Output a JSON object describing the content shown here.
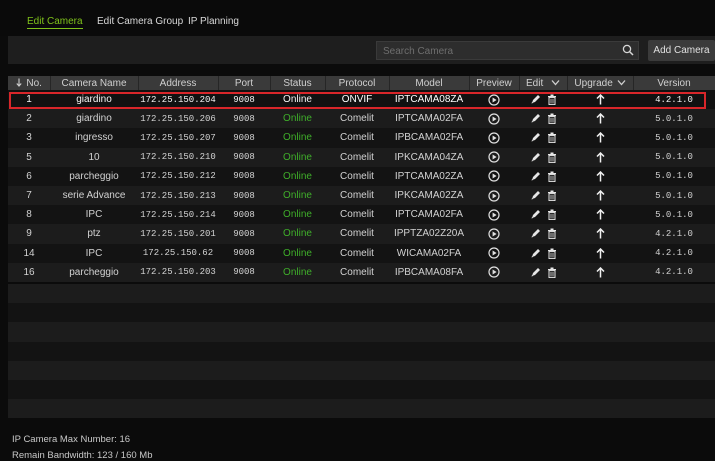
{
  "tabs": [
    {
      "label": "Edit Camera",
      "active": true
    },
    {
      "label": "Edit Camera Group",
      "active": false
    },
    {
      "label": "IP Planning",
      "active": false
    }
  ],
  "toolbar": {
    "search_placeholder": "Search Camera",
    "search_value": "",
    "add_label": "Add Camera"
  },
  "table": {
    "columns": [
      "No.",
      "Camera Name",
      "Address",
      "Port",
      "Status",
      "Protocol",
      "Model",
      "Preview",
      "Edit",
      "Upgrade",
      "Version"
    ],
    "rows": [
      {
        "no": "1",
        "name": "giardino",
        "address": "172.25.150.204",
        "port": "9008",
        "status": "Online",
        "protocol": "ONVIF",
        "model": "IPTCAMA08ZA",
        "version": "4.2.1.0"
      },
      {
        "no": "2",
        "name": "giardino",
        "address": "172.25.150.206",
        "port": "9008",
        "status": "Online",
        "protocol": "Comelit",
        "model": "IPTCAMA02FA",
        "version": "5.0.1.0"
      },
      {
        "no": "3",
        "name": "ingresso",
        "address": "172.25.150.207",
        "port": "9008",
        "status": "Online",
        "protocol": "Comelit",
        "model": "IPBCAMA02FA",
        "version": "5.0.1.0"
      },
      {
        "no": "5",
        "name": "10",
        "address": "172.25.150.210",
        "port": "9008",
        "status": "Online",
        "protocol": "Comelit",
        "model": "IPKCAMA04ZA",
        "version": "5.0.1.0"
      },
      {
        "no": "6",
        "name": "parcheggio",
        "address": "172.25.150.212",
        "port": "9008",
        "status": "Online",
        "protocol": "Comelit",
        "model": "IPTCAMA02ZA",
        "version": "5.0.1.0"
      },
      {
        "no": "7",
        "name": "serie Advance",
        "address": "172.25.150.213",
        "port": "9008",
        "status": "Online",
        "protocol": "Comelit",
        "model": "IPKCAMA02ZA",
        "version": "5.0.1.0"
      },
      {
        "no": "8",
        "name": "IPC",
        "address": "172.25.150.214",
        "port": "9008",
        "status": "Online",
        "protocol": "Comelit",
        "model": "IPTCAMA02FA",
        "version": "5.0.1.0"
      },
      {
        "no": "9",
        "name": "ptz",
        "address": "172.25.150.201",
        "port": "9008",
        "status": "Online",
        "protocol": "Comelit",
        "model": "IPPTZA02Z20A",
        "version": "4.2.1.0"
      },
      {
        "no": "14",
        "name": "IPC",
        "address": "172.25.150.62",
        "port": "9008",
        "status": "Online",
        "protocol": "Comelit",
        "model": "WICAMA02FA",
        "version": "4.2.1.0"
      },
      {
        "no": "16",
        "name": "parcheggio",
        "address": "172.25.150.203",
        "port": "9008",
        "status": "Online",
        "protocol": "Comelit",
        "model": "IPBCAMA08FA",
        "version": "4.2.1.0"
      }
    ]
  },
  "footer": {
    "max_number": "IP Camera Max Number: 16",
    "bandwidth": "Remain Bandwidth: 123 / 160 Mb"
  },
  "colors": {
    "accent": "#7fc21b",
    "online": "#3fae2a",
    "selection_border": "#d8262a"
  }
}
